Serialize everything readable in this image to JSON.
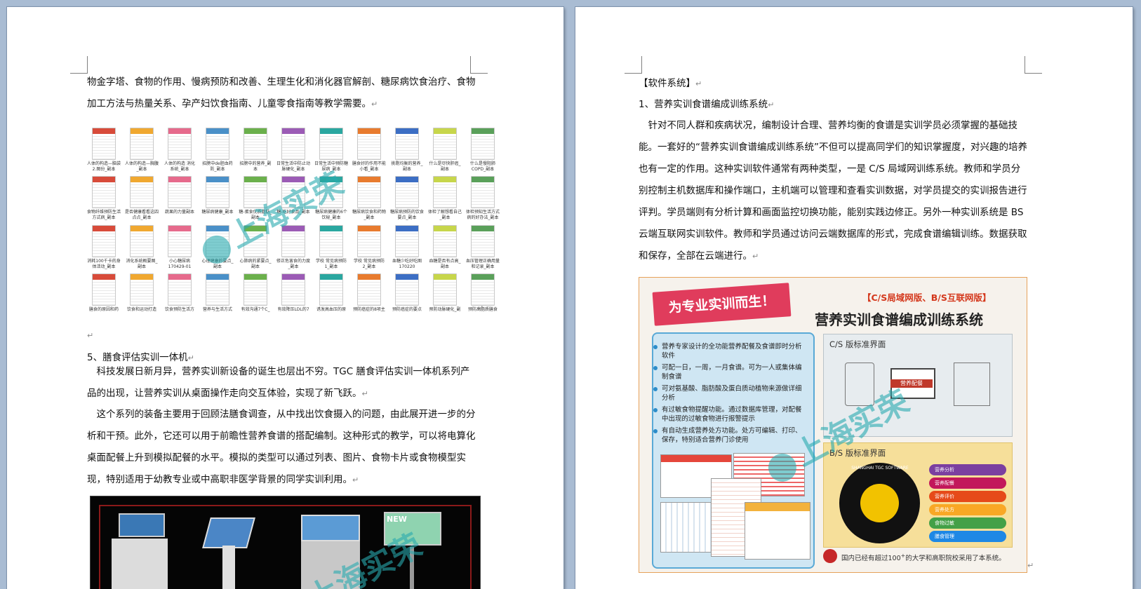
{
  "left_page": {
    "para1": "物金字塔、食物的作用、慢病预防和改善、生理生化和消化器官解剖、糖尿病饮食治疗、食物加工方法与热量关系、孕产妇饮食指南、儿童零食指南等教学需要。",
    "poster_captions": [
      "人体的构造—脑袋2.图份_副本",
      "人体的构造—胸腹_副本",
      "人体的构造 消化系统_副本",
      "招膀中de胆血药防_副本",
      "招膀中的营养_副本",
      "日常生活中防止动脉硬化_副本",
      "日常生活中预防糖尿病_副本",
      "膳食好的作用不能小看_副本",
      "挑剔均衡的营养_副本",
      "什么是尽快肝癌_副本",
      "什么是慢阻肺COPD_副本",
      "食物纤维预防生活方式病_副本",
      "是否健康看看这四点点_副本",
      "蔬果的力量副本",
      "糖尿病健康_副本",
      "糖-蛋食优质脂肪_副本",
      "糖-吃好食品_副本",
      "糖尿病健康的6个饮秘_副本",
      "糖尿病饮食和药物_副本",
      "糖尿病预防的饮食要点_副本",
      "体检了解想看自己_副本",
      "体检预知生活方式病的好办法_副本",
      "消耗100千卡的身体活动_副本",
      "消化系统概要图_副本",
      "小心糖尿病170429-01",
      "心理健康的要点_副本",
      "心肺病的紧要点_副本",
      "修正危害食的力度_副本",
      "学校 常见病预防1_副本",
      "学校 常见病预防2_副本",
      "血糖少吃好吃图170220",
      "血糖是否有点高_副本",
      "血压管理正确用量和记录_副本",
      "膳食的原因和药",
      "饮食和运动打造",
      "饮食预防生活方",
      "营养与生活方式",
      "有效沟通7个C_",
      "有效降压LDL的7",
      "诱发高血压的原",
      "预防癌症的8项主",
      "预防癌症的要点",
      "预防动脉硬化_副",
      "预防高脂质膳食"
    ],
    "heading5": "5、膳食评估实训一体机",
    "para2": "科技发展日新月异，营养实训新设备的诞生也层出不穷。TGC 膳食评估实训一体机系列产品的出现，让营养实训从桌面操作走向交互体验，实现了新飞跃。",
    "para3": "这个系列的装备主要用于回顾法膳食调查，从中找出饮食摄入的问题，由此展开进一步的分析和干预。此外，它还可以用于前瞻性营养食谱的搭配编制。这种形式的教学，可以将电算化桌面配餐上升到模拟配餐的水平。模拟的类型可以通过列表、图片、食物卡片或食物模型实现，特别适用于幼教专业或中高职非医学背景的同学实训利用。",
    "equip_sign": "NEW"
  },
  "right_page": {
    "section": "【软件系统】",
    "heading1": "1、营养实训食谱编成训练系统",
    "para1": "针对不同人群和疾病状况，编制设计合理、营养均衡的食谱是实训学员必须掌握的基础技能。一套好的“营养实训食谱编成训练系统”不但可以提高同学们的知识掌握度，对兴趣的培养也有一定的作用。这种实训软件通常有两种类型，一是 C/S 局域网训练系统。教师和学员分别控制主机数据库和操作端口，主机端可以管理和查看实训数据，对学员提交的实训报告进行评判。学员端则有分析计算和画面监控切换功能，能别实践边修正。另外一种实训系统是 BS 云端互联网实训软件。教师和学员通过访问云端数据库的形式，完成食谱编辑训练。数据获取和保存，全部在云端进行。"
  },
  "brochure": {
    "ribbon": "为专业实训而生！",
    "tag": "【C/S局域网版、B/S互联网版】",
    "title": "营养实训食谱编成训练系统",
    "features": [
      "营养专家设计的全功能营养配餐及食谱即时分析软件",
      "可配一日，一周，一月食谱。可为一人或集体编制食谱",
      "可对氨基酸、脂肪酸及蛋白质动植物来源做详细分析",
      "有过敏食物提醒功能。通过数据库管理，对配餐中出现的过敏食物进行报警提示",
      "有自动生成营养处方功能。处方可编辑、打印、保存，特别适合营养门诊使用"
    ],
    "cs_label": "C/S 版标准界面",
    "cs_screen": "营养配餐",
    "bs_label": "B/S 版标准界面",
    "bs_circle": "SHANGHAI TGC SOFTWARE",
    "bs_menu": [
      "营养分析",
      "营养配餐",
      "营养评价",
      "营养处方",
      "食物过敏",
      "膳食管理"
    ],
    "footer_pre": "国内已经有超过100",
    "footer_sup": "+",
    "footer_post": "的大学和高职院校采用了本系统。"
  },
  "watermark": "上海实荣",
  "colors": {
    "poster_bands": [
      "#d84b3a",
      "#f0a830",
      "#e66a8c",
      "#4a90c8",
      "#6bb04c",
      "#9b5bb5",
      "#2aa7a0",
      "#e87b2e",
      "#3c6ec4",
      "#c7d64b",
      "#5aa05a"
    ]
  }
}
